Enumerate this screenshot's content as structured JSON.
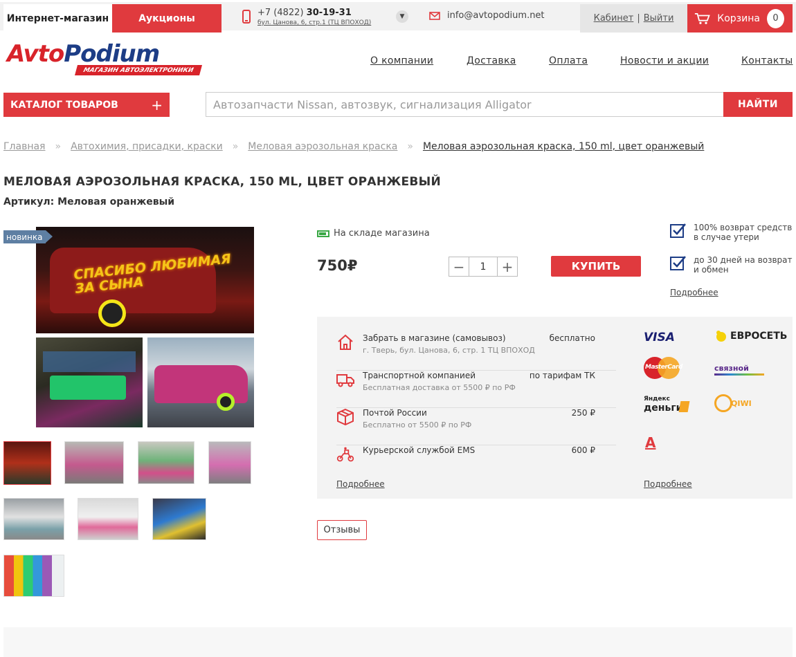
{
  "topbar": {
    "shop_tab": "Интернет-магазин",
    "auction_tab": "Аукционы",
    "phone_prefix": "+7 (4822)",
    "phone_number": "30-19-31",
    "address": "бул. Цанова, 6, стр.1 (ТЦ ВПОХОД)",
    "email": "info@avtopodium.net",
    "cabinet": "Кабинет",
    "logout": "Выйти",
    "cart_label": "Корзина",
    "cart_count": "0"
  },
  "logo": {
    "part1": "Avto",
    "part2": "Podium",
    "tagline": "МАГАЗИН АВТОЭЛЕКТРОНИКИ"
  },
  "nav": [
    "О компании",
    "Доставка",
    "Оплата",
    "Новости и акции",
    "Контакты"
  ],
  "catalog_button": "КАТАЛОГ ТОВАРОВ",
  "search": {
    "placeholder": "Автозапчасти Nissan, автозвук, сигнализация Alligator",
    "button": "НАЙТИ"
  },
  "breadcrumb": [
    "Главная",
    "Автохимия, присадки, краски",
    "Меловая аэрозольная краска",
    "Меловая аэрозольная краска, 150 ml, цвет оранжевый"
  ],
  "product": {
    "title": "МЕЛОВАЯ АЭРОЗОЛЬНАЯ КРАСКА, 150 ML, ЦВЕТ ОРАНЖЕВЫЙ",
    "sku": "Артикул: Меловая оранжевый",
    "badge": "новинка",
    "stock": "На складе магазина",
    "price": "750₽",
    "quantity": "1",
    "buy_button": "КУПИТЬ",
    "main_image_text": "СПАСИБО ЛЮБИМАЯ ЗА СЫНА"
  },
  "guarantees": [
    "100% возврат средств в случае утери",
    "до 30 дней на возврат и обмен"
  ],
  "more_link": "Подробнее",
  "delivery": [
    {
      "name": "Забрать в магазине (самовывоз)",
      "note": "г. Тверь, бул. Цанова, 6, стр. 1 ТЦ ВПОХОД",
      "price": "бесплатно",
      "icon": "house-icon"
    },
    {
      "name": "Транспортной компанией",
      "note": "Бесплатная доставка от 5500 ₽ по РФ",
      "price": "по тарифам ТК",
      "icon": "truck-icon"
    },
    {
      "name": "Почтой России",
      "note": "Бесплатно от 5500 ₽ по РФ",
      "price": "250 ₽",
      "icon": "box-icon"
    },
    {
      "name": "Курьерской службой EMS",
      "note": "",
      "price": "600 ₽",
      "icon": "courier-icon"
    }
  ],
  "payments": {
    "visa": "VISA",
    "evroset": "ЕВРОСЕТЬ",
    "mastercard": "MasterCard",
    "svyaznoy": "связной",
    "yandex_small": "Яндекс",
    "yandex": "деньги",
    "qiwi": "QIWI",
    "alfa": "А"
  },
  "reviews": "Отзывы",
  "colors": {
    "accent": "#e03a3e",
    "brand_blue": "#1d3d86",
    "badge": "#5e7fa3",
    "stock_green": "#3aa845"
  }
}
